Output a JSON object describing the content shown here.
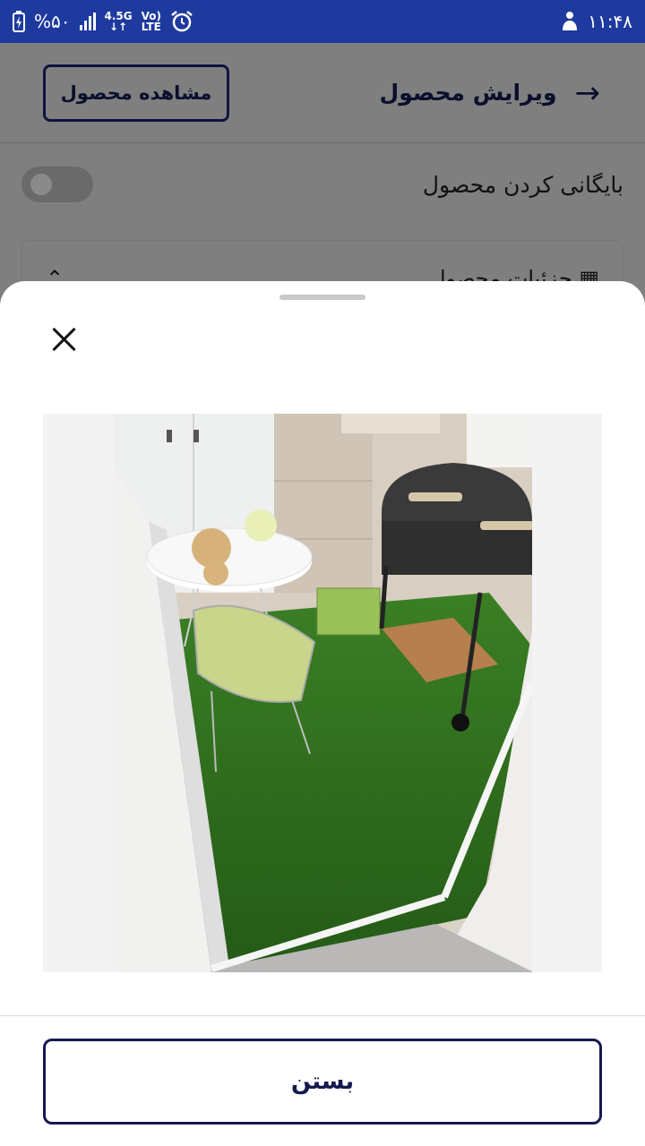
{
  "status_bar": {
    "battery_percent": "%۵۰",
    "network_type": "4.5G",
    "volte": "Vo)",
    "lte": "LTE",
    "time": "۱۱:۴۸"
  },
  "header": {
    "title": "ویرایش محصول",
    "view_button_label": "مشاهده محصول"
  },
  "archive": {
    "label": "بایگانی کردن محصول",
    "enabled": false
  },
  "details": {
    "label": "جزئیات محصول"
  },
  "sheet": {
    "close_button_label": "بستن",
    "image_alt": "balcony with artificial grass, white table, wire chair and barbecue grill"
  },
  "colors": {
    "status_bar": "#1e3a9e",
    "primary_dark": "#14194f",
    "grass": "#2f6d1d"
  },
  "icons": [
    "charging-battery-icon",
    "signal-bars-icon",
    "alarm-icon",
    "location-person-icon",
    "arrow-right-icon",
    "close-icon",
    "grid-icon",
    "chevron-up-icon"
  ]
}
